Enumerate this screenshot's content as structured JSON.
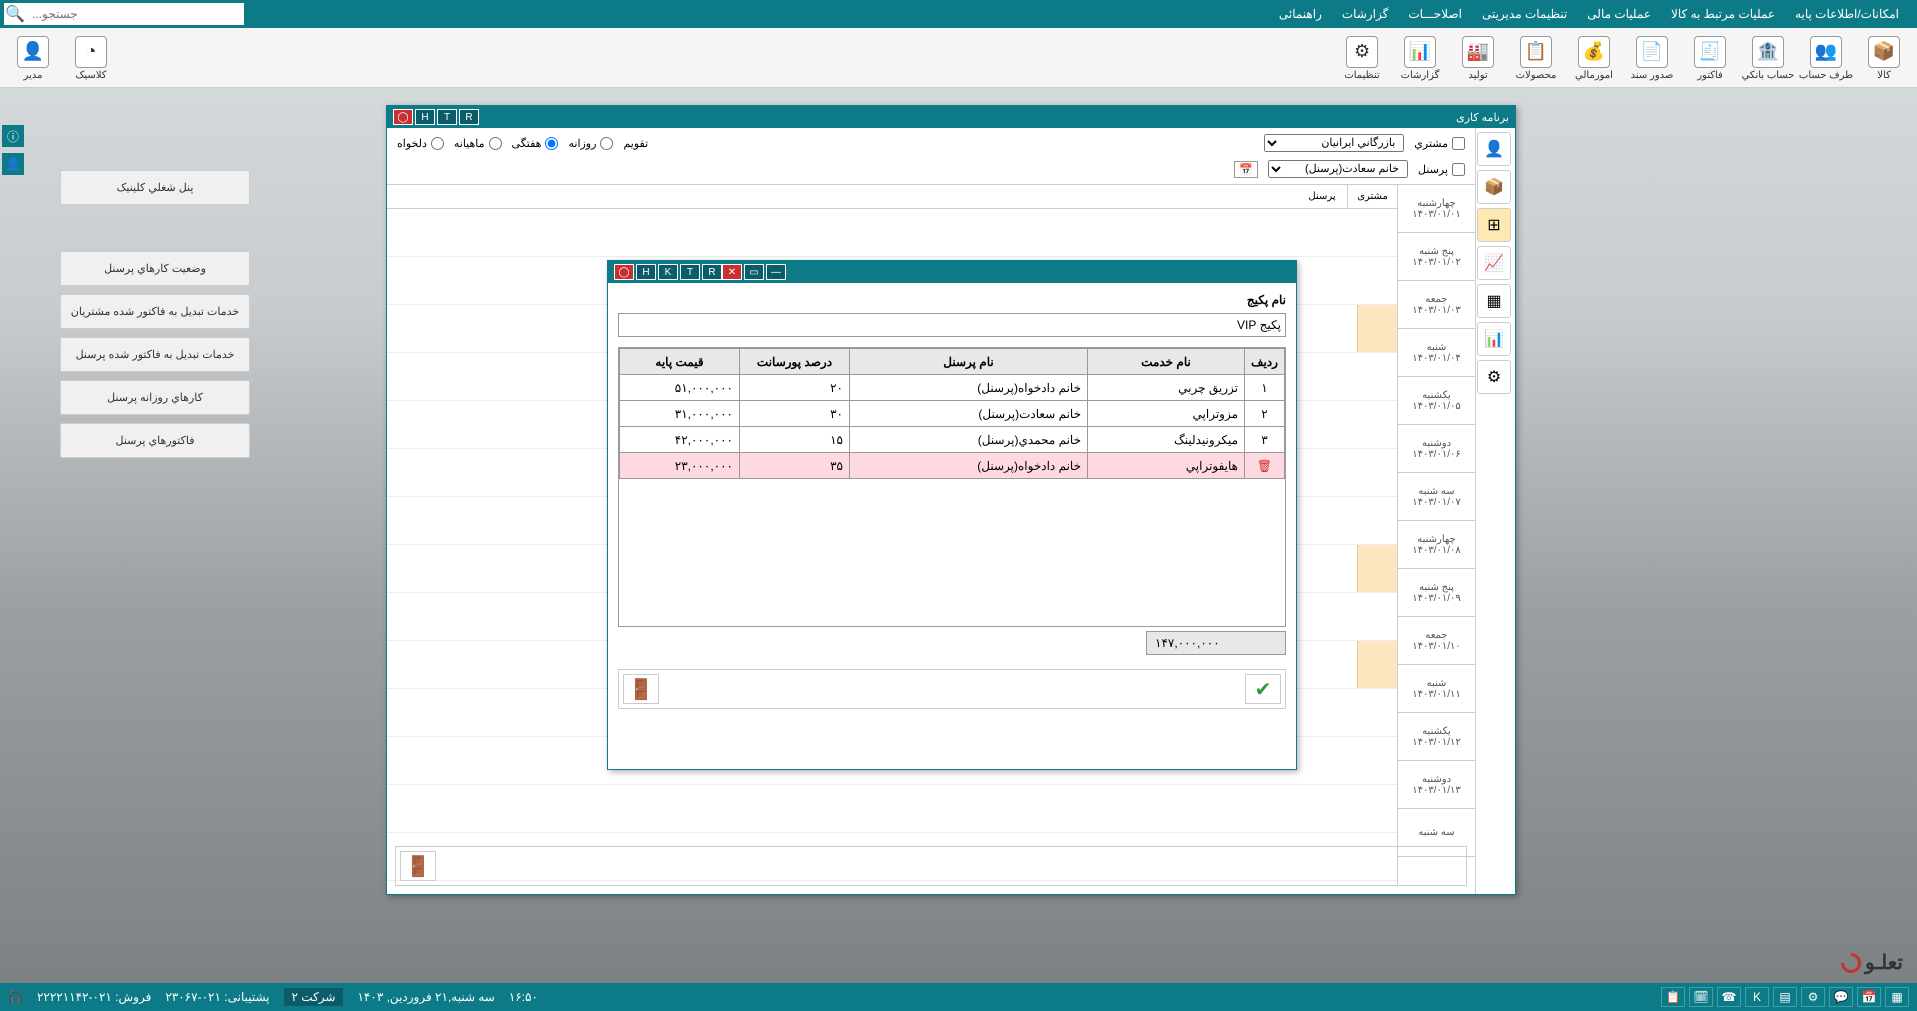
{
  "menubar": [
    "امکانات/اطلاعات پایه",
    "عملیات مرتبط به کالا",
    "عملیات مالی",
    "تنظیمات مدیریتی",
    "اصلاحـــات",
    "گزارشات",
    "راهنمائی"
  ],
  "search": {
    "placeholder": "جستجو..."
  },
  "toolbar": [
    {
      "label": "کالا",
      "icon": "📦"
    },
    {
      "label": "طرف حساب",
      "icon": "👥"
    },
    {
      "label": "حساب بانکي",
      "icon": "🏦"
    },
    {
      "label": "فاکتور",
      "icon": "🧾"
    },
    {
      "label": "صدور سند",
      "icon": "📄"
    },
    {
      "label": "امورمالي",
      "icon": "💰"
    },
    {
      "label": "محصولات",
      "icon": "📋"
    },
    {
      "label": "تولید",
      "icon": "🏭"
    },
    {
      "label": "گزارشات",
      "icon": "📊"
    },
    {
      "label": "تنظیمات",
      "icon": "⚙"
    }
  ],
  "toolbar_left": [
    {
      "label": "کلاسیک",
      "icon": "◔"
    },
    {
      "label": "مدیر",
      "icon": "👤"
    }
  ],
  "side_buttons": [
    "پنل شغلي کلینیک",
    "وضعیت کارهاي پرسنل",
    "خدمات تبدیل به فاکتور شده مشتریان",
    "خدمات تبدیل به فاکتور شده پرسنل",
    "کارهاي روزانه پرسنل",
    "فاکتورهاي پرسنل"
  ],
  "schedule": {
    "title": "برنامه کاری",
    "keys": [
      "R",
      "T",
      "H"
    ],
    "customer_check": "مشتري",
    "customer_value": "بازرگاني ايرانيان",
    "personnel_check": "پرسنل",
    "personnel_value": "خانم سعادت(پرسنل)",
    "calendar_label": "تقویم",
    "view_options": [
      "روزانه",
      "هفتگی",
      "ماهیانه",
      "دلخواه"
    ],
    "view_selected": "هفتگی",
    "col1": "مشتری",
    "col2": "پرسنل",
    "dates": [
      {
        "d": "چهارشنبه",
        "n": "۱۴۰۳/۰۱/۰۱"
      },
      {
        "d": "پنج شنبه",
        "n": "۱۴۰۳/۰۱/۰۲"
      },
      {
        "d": "جمعه",
        "n": "۱۴۰۳/۰۱/۰۳"
      },
      {
        "d": "شنبه",
        "n": "۱۴۰۳/۰۱/۰۴"
      },
      {
        "d": "یکشنبه",
        "n": "۱۴۰۳/۰۱/۰۵"
      },
      {
        "d": "دوشنبه",
        "n": "۱۴۰۳/۰۱/۰۶"
      },
      {
        "d": "سه شنبه",
        "n": "۱۴۰۳/۰۱/۰۷"
      },
      {
        "d": "چهارشنبه",
        "n": "۱۴۰۳/۰۱/۰۸"
      },
      {
        "d": "پنج شنبه",
        "n": "۱۴۰۳/۰۱/۰۹"
      },
      {
        "d": "جمعه",
        "n": "۱۴۰۳/۰۱/۱۰"
      },
      {
        "d": "شنبه",
        "n": "۱۴۰۳/۰۱/۱۱"
      },
      {
        "d": "یکشنبه",
        "n": "۱۴۰۳/۰۱/۱۲"
      },
      {
        "d": "دوشنبه",
        "n": "۱۴۰۳/۰۱/۱۳"
      },
      {
        "d": "سه شنبه",
        "n": ""
      }
    ]
  },
  "package": {
    "title": "",
    "keys": [
      "R",
      "T",
      "K",
      "H"
    ],
    "name_label": "نام پکیج",
    "name_value": "پکیج VIP",
    "headers": [
      "ردیف",
      "نام خدمت",
      "نام پرسنل",
      "درصد پورسانت",
      "قیمت پایه"
    ],
    "rows": [
      {
        "n": "۱",
        "service": "تزريق چربي",
        "person": "خانم دادخواه(پرسنل)",
        "percent": "۲۰",
        "price": "۵۱,۰۰۰,۰۰۰"
      },
      {
        "n": "۲",
        "service": "مزوتراپي",
        "person": "خانم سعادت(پرسنل)",
        "percent": "۳۰",
        "price": "۳۱,۰۰۰,۰۰۰"
      },
      {
        "n": "۳",
        "service": "ميکرونيدلينگ",
        "person": "خانم محمدي(پرسنل)",
        "percent": "۱۵",
        "price": "۴۲,۰۰۰,۰۰۰"
      },
      {
        "n": "",
        "service": "هايفوتراپي",
        "person": "خانم دادخواه(پرسنل)",
        "percent": "۳۵",
        "price": "۲۳,۰۰۰,۰۰۰",
        "active": true,
        "del": true
      }
    ],
    "total": "۱۴۷,۰۰۰,۰۰۰"
  },
  "status": {
    "sales_label": "فروش:",
    "sales_phone": "۰۲۱-۲۲۲۲۱۱۴۲",
    "support_label": "پشتیبانی:",
    "support_phone": "۰۲۱-۲۳۰۶۷",
    "company": "شرکت ۲",
    "date": "سه شنبه,۲۱ فروردین, ۱۴۰۳",
    "time": "۱۶:۵۰"
  },
  "logo": "تعلـو"
}
